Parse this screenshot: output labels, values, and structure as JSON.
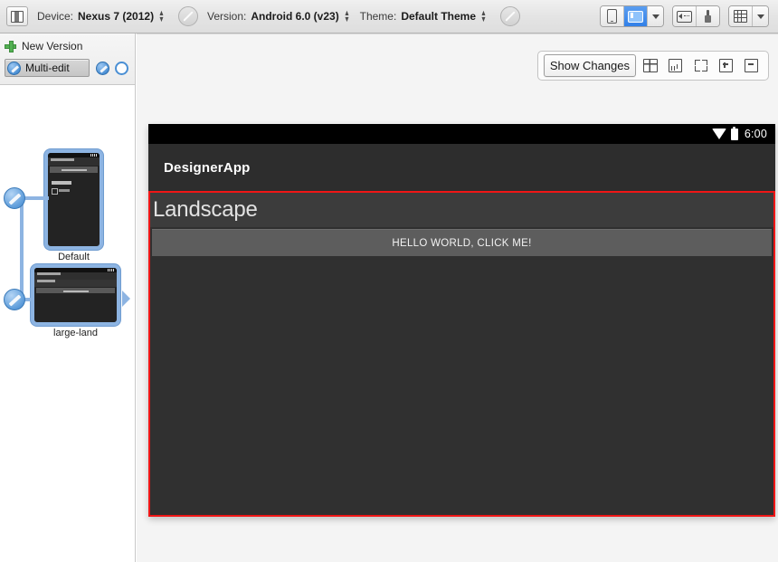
{
  "toolbar": {
    "layout_icon": "layout-editor-icon",
    "device_label": "Device:",
    "device_value": "Nexus 7 (2012)",
    "disabled_icon_1": "no-edit-circle-icon",
    "version_label": "Version:",
    "version_value": "Android 6.0 (v23)",
    "theme_label": "Theme:",
    "theme_value": "Default Theme",
    "disabled_icon_2": "no-edit-circle-icon",
    "right_buttons": [
      {
        "name": "portrait-orientation-button",
        "icon": "phone-portrait-icon",
        "active": false
      },
      {
        "name": "landscape-orientation-button",
        "icon": "phone-landscape-icon",
        "active": true
      },
      {
        "name": "orientation-dropdown-button",
        "icon": "chevron-down-icon",
        "active": false
      },
      {
        "name": "rtl-direction-button",
        "icon": "back-arrow-box-icon",
        "active": false
      },
      {
        "name": "brush-button",
        "icon": "paintbrush-icon",
        "active": false
      },
      {
        "name": "grid-view-button",
        "icon": "grid-icon",
        "active": false
      },
      {
        "name": "grid-dropdown-button",
        "icon": "chevron-down-icon",
        "active": false
      }
    ]
  },
  "sidebar": {
    "new_version_icon": "green-plus-icon",
    "new_version_label": "New Version",
    "multi_edit_icon": "pencil-circle-icon",
    "multi_edit_label": "Multi-edit",
    "extra_pencil_icon": "pencil-circle-icon",
    "extra_circle_icon": "empty-circle-icon",
    "variants": [
      {
        "name": "variant-default",
        "caption": "Default",
        "orientation": "portrait",
        "node_icon": "pencil-node-icon"
      },
      {
        "name": "variant-large-land",
        "caption": "large-land",
        "orientation": "landscape",
        "node_icon": "pencil-node-icon"
      }
    ]
  },
  "canvas": {
    "toolbar": {
      "show_changes_label": "Show Changes",
      "buttons": [
        {
          "name": "split-view-button",
          "icon": "split-layout-icon"
        },
        {
          "name": "statistics-button",
          "icon": "bar-chart-icon"
        },
        {
          "name": "fit-to-screen-button",
          "icon": "expand-corners-icon"
        },
        {
          "name": "zoom-in-button",
          "icon": "zoom-in-icon"
        },
        {
          "name": "zoom-out-button",
          "icon": "zoom-out-icon"
        }
      ]
    },
    "device_preview": {
      "status_bar": {
        "wifi_icon": "wifi-icon",
        "battery_icon": "battery-icon",
        "time": "6:00"
      },
      "app_bar_title": "DesignerApp",
      "selection_border_color": "#f01616",
      "text_view": "Landscape",
      "button_label": "HELLO WORLD, CLICK ME!"
    }
  }
}
